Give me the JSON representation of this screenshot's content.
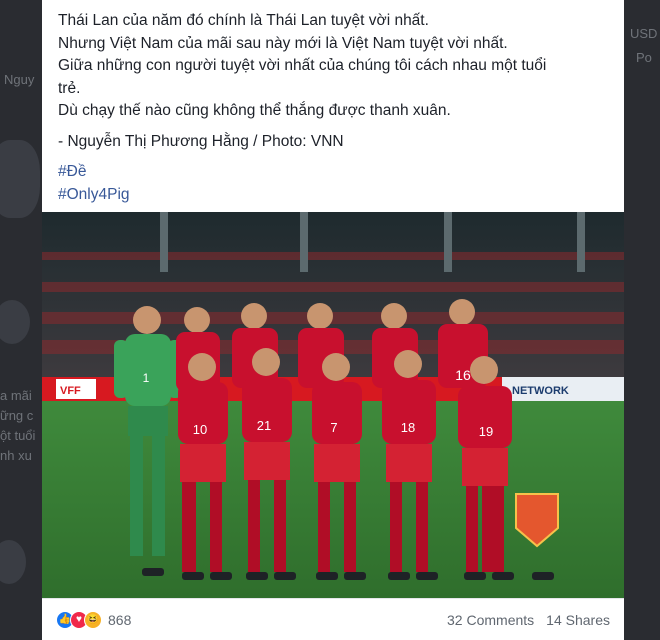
{
  "background": {
    "left_lines": [
      "Nguy",
      "a mãi",
      "ững c",
      "ột tuổi",
      "nh xu"
    ],
    "right_lines": [
      "USD",
      "Po"
    ]
  },
  "post": {
    "lines": [
      "Thái Lan của năm đó chính là Thái Lan tuyệt vời nhất.",
      "Nhưng Việt Nam của mãi sau này mới là Việt Nam tuyệt vời nhất.",
      "Giữa những con người tuyệt vời nhất của chúng tôi cách nhau một tuổi",
      "trẻ.",
      "Dù chạy thế nào cũng không thể thắng được thanh xuân."
    ],
    "credit": "- Nguyễn Thị Phương Hằng / Photo: VNN",
    "hashtags": [
      "#Đề",
      "#Only4Pig"
    ],
    "photo": {
      "sponsor_board": "VFF",
      "ad_board": "NETWORK",
      "shirt_numbers_back": [
        "1",
        "",
        "",
        "",
        "",
        ""
      ],
      "shirt_numbers_front": [
        "10",
        "21",
        "7",
        "18",
        "19"
      ],
      "back_row_extra": [
        "16"
      ]
    }
  },
  "footer": {
    "reaction_count": "868",
    "comments": "32 Comments",
    "shares": "14 Shares"
  },
  "colors": {
    "link": "#385898",
    "like": "#1877f2",
    "love": "#f0284a",
    "haha": "#f7b125",
    "jersey_red": "#c8102e",
    "keeper_green": "#3aa35a"
  }
}
